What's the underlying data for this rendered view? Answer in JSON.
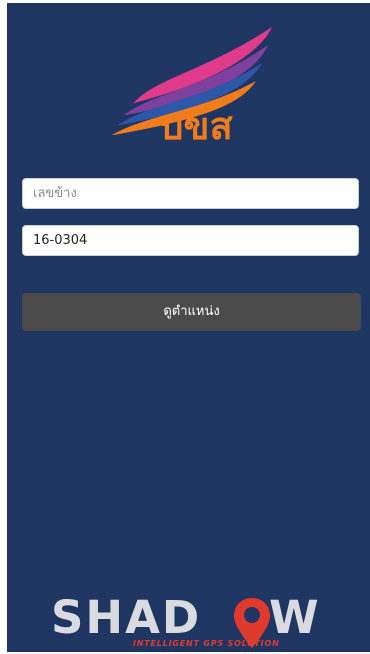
{
  "colors": {
    "background": "#1f3562",
    "button": "#4b4b4b",
    "brand_orange": "#f07c1b",
    "brand_blue": "#2e56a9",
    "brand_pink": "#e03b8a",
    "shadow_red": "#e03a2f"
  },
  "brand": {
    "logo_text": "บขส"
  },
  "form": {
    "plate_placeholder": "เลขข้าง",
    "code_value": "16-0304",
    "submit_label": "ดูตำแหน่ง"
  },
  "footer": {
    "logo_left": "SHAD",
    "logo_right": "W",
    "tagline": "INTELLIGENT GPS SOLUTION",
    "pin_icon": "map-pin-icon"
  }
}
